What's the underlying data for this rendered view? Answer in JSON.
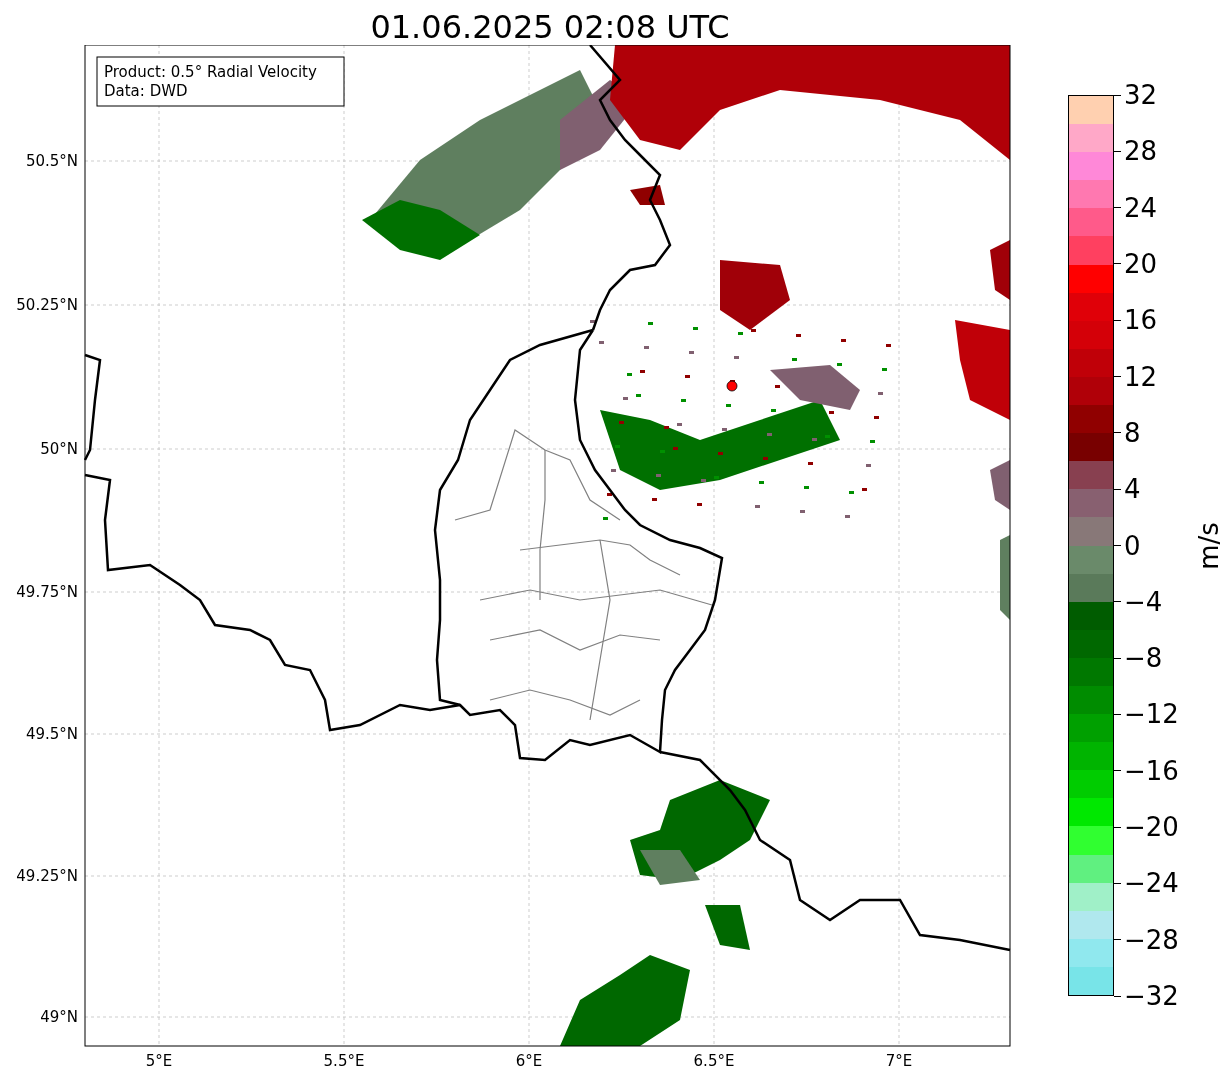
{
  "title": "01.06.2025 02:08 UTC",
  "info_box": {
    "lines": [
      "Product: 0.5° Radial Velocity",
      "Data: DWD"
    ]
  },
  "map": {
    "lat_labels": [
      "50.5°N",
      "50.25°N",
      "50°N",
      "49.75°N",
      "49.5°N",
      "49.25°N",
      "49°N"
    ],
    "lon_labels": [
      "5°E",
      "5.5°E",
      "6°E",
      "6.5°E",
      "7°E"
    ]
  },
  "colorbar": {
    "label": "m/s",
    "ticks": [
      "32",
      "28",
      "24",
      "20",
      "16",
      "12",
      "8",
      "4",
      "0",
      "−4",
      "−8",
      "−12",
      "−16",
      "−20",
      "−24",
      "−28",
      "−32"
    ],
    "segments": [
      {
        "color": "#ffd0b0"
      },
      {
        "color": "#ffa8c8"
      },
      {
        "color": "#ff88d8"
      },
      {
        "color": "#ff78b0"
      },
      {
        "color": "#ff5a8a"
      },
      {
        "color": "#ff4060"
      },
      {
        "color": "#ff0000"
      },
      {
        "color": "#e00008"
      },
      {
        "color": "#d40008"
      },
      {
        "color": "#c00008"
      },
      {
        "color": "#b00008"
      },
      {
        "color": "#900000"
      },
      {
        "color": "#780000"
      },
      {
        "color": "#884050"
      },
      {
        "color": "#886070"
      },
      {
        "color": "#887878"
      },
      {
        "color": "#6a8a6a"
      },
      {
        "color": "#5a7a5a"
      },
      {
        "color": "#005c00"
      },
      {
        "color": "#006800"
      },
      {
        "color": "#007800"
      },
      {
        "color": "#008c00"
      },
      {
        "color": "#00a000"
      },
      {
        "color": "#00b400"
      },
      {
        "color": "#00cc00"
      },
      {
        "color": "#00e800"
      },
      {
        "color": "#30ff30"
      },
      {
        "color": "#60f080"
      },
      {
        "color": "#a0f0c8"
      },
      {
        "color": "#b0e8ee"
      },
      {
        "color": "#90e8ee"
      },
      {
        "color": "#78e4e8"
      }
    ]
  }
}
